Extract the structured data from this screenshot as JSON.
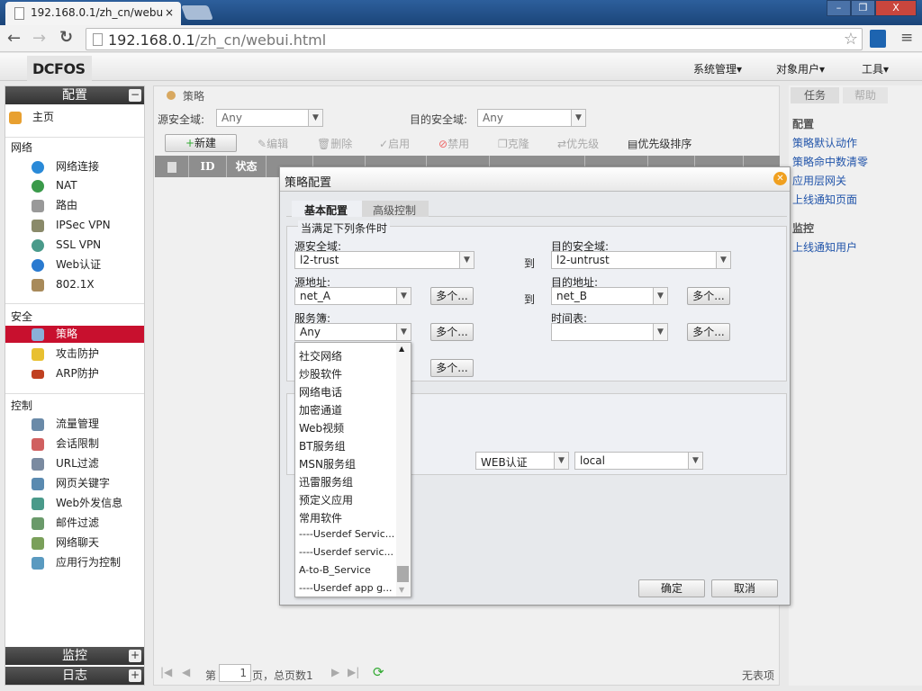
{
  "browser": {
    "tab_title": "192.168.0.1/zh_cn/webui.html",
    "tab_title_short": "192.168.0.1/zh_cn/webu",
    "url_host": "192.168.0.1",
    "url_path": "/zh_cn/webui.html"
  },
  "app": {
    "logo": "DCFOS",
    "menus": [
      "系统管理▾",
      "对象用户▾",
      "工具▾"
    ]
  },
  "sidebar": {
    "header": "配置",
    "home": "主页",
    "groups": [
      {
        "label": "网络",
        "items": [
          "网络连接",
          "NAT",
          "路由",
          "IPSec VPN",
          "SSL VPN",
          "Web认证",
          "802.1X"
        ]
      },
      {
        "label": "安全",
        "items": [
          "策略",
          "攻击防护",
          "ARP防护"
        ]
      },
      {
        "label": "控制",
        "items": [
          "流量管理",
          "会话限制",
          "URL过滤",
          "网页关键字",
          "Web外发信息",
          "邮件过滤",
          "网络聊天",
          "应用行为控制"
        ]
      }
    ],
    "selected": "策略",
    "footer": [
      "监控",
      "日志"
    ]
  },
  "main": {
    "breadcrumb": "策略",
    "src_zone_label": "源安全域:",
    "src_zone_value": "Any",
    "dst_zone_label": "目的安全域:",
    "dst_zone_value": "Any",
    "toolbar": [
      "新建",
      "编辑",
      "删除",
      "启用",
      "禁用",
      "克隆",
      "优先级",
      "优先级排序"
    ],
    "columns": [
      "ID",
      "状态"
    ],
    "pager": {
      "page_prefix": "第",
      "page": "1",
      "page_suffix": "页，总页数1",
      "empty": "无表项"
    }
  },
  "right": {
    "tabs": [
      "任务",
      "帮助"
    ],
    "config_head": "配置",
    "config_links": [
      "策略默认动作",
      "策略命中数清零",
      "应用层网关",
      "上线通知页面"
    ],
    "monitor_head": "监控",
    "monitor_links": [
      "上线通知用户"
    ]
  },
  "dialog": {
    "title": "策略配置",
    "tabs": [
      "基本配置",
      "高级控制"
    ],
    "legend": "当满足下列条件时",
    "src_zone_label": "源安全域:",
    "src_zone": "l2-trust",
    "dst_zone_label": "目的安全域:",
    "dst_zone": "l2-untrust",
    "to": "到",
    "src_addr_label": "源地址:",
    "src_addr": "net_A",
    "dst_addr_label": "目的地址:",
    "dst_addr": "net_B",
    "service_label": "服务簿:",
    "service": "Any",
    "schedule_label": "时间表:",
    "schedule": "",
    "more": "多个...",
    "auth": "WEB认证",
    "auth_server": "local",
    "ok": "确定",
    "cancel": "取消",
    "service_options": [
      "社交网络",
      "炒股软件",
      "网络电话",
      "加密通道",
      "Web视频",
      "BT服务组",
      "MSN服务组",
      "迅雷服务组",
      "预定义应用",
      "常用软件",
      "----Userdef Servic...",
      "----Userdef servic...",
      "A-to-B_Service",
      "----Userdef app g..."
    ]
  }
}
